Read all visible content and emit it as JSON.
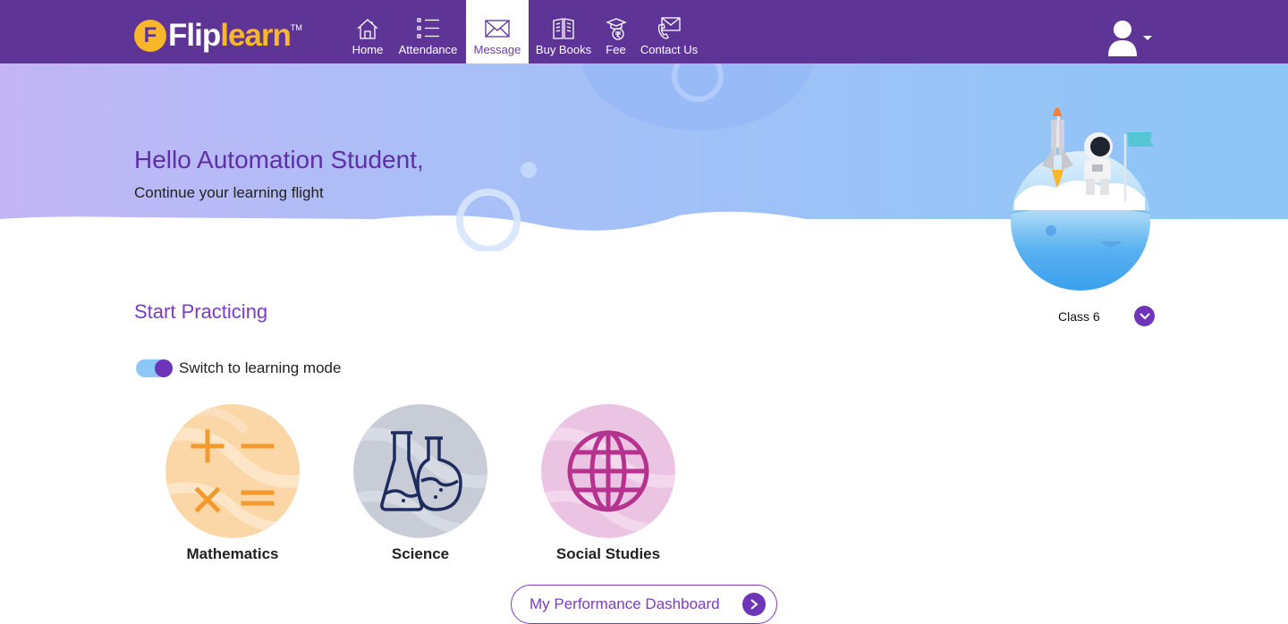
{
  "brand": {
    "name_part1": "Flip",
    "name_part2": "learn",
    "badge_letter": "F",
    "trademark": "TM"
  },
  "nav": {
    "items": [
      {
        "label": "Home",
        "icon": "home-icon"
      },
      {
        "label": "Attendance",
        "icon": "list-icon"
      },
      {
        "label": "Message",
        "icon": "envelope-icon",
        "active": true
      },
      {
        "label": "Buy Books",
        "icon": "book-icon"
      },
      {
        "label": "Fee",
        "icon": "fee-icon"
      },
      {
        "label": "Contact Us",
        "icon": "contact-icon"
      }
    ],
    "user_icon": "user-avatar-icon"
  },
  "hero": {
    "greeting": "Hello Automation Student,",
    "subtitle": "Continue your learning flight"
  },
  "practice": {
    "title": "Start Practicing",
    "class_selected": "Class 6",
    "toggle_label": "Switch to learning mode",
    "toggle_on": true,
    "subjects": [
      {
        "name": "Mathematics",
        "icon": "math-symbols-icon"
      },
      {
        "name": "Science",
        "icon": "flasks-icon"
      },
      {
        "name": "Social Studies",
        "icon": "globe-icon"
      }
    ],
    "dashboard_button": "My Performance Dashboard"
  },
  "colors": {
    "nav_bg": "#5e3596",
    "accent": "#6e35b8",
    "logo_yellow": "#f8b62b",
    "math_orange": "#f39a2e",
    "science_navy": "#1f2d5e",
    "social_magenta": "#b5338f"
  }
}
